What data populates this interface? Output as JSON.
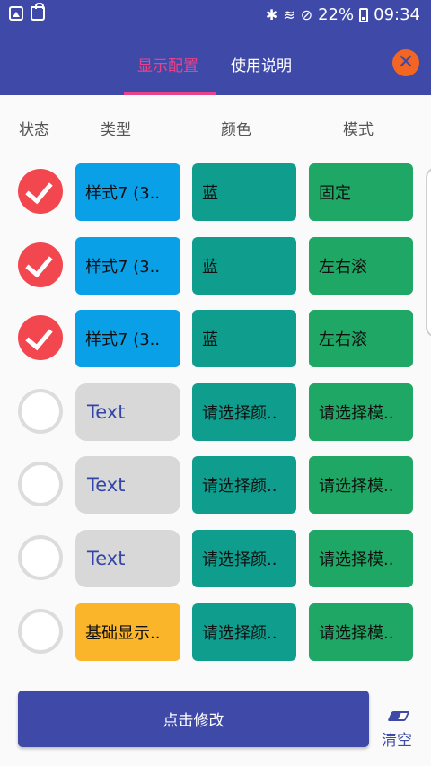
{
  "status_bar": {
    "battery": "22%",
    "time": "09:34",
    "icons": [
      "image-icon",
      "bag-icon",
      "bluetooth-icon",
      "wifi-icon",
      "dnd-icon",
      "battery-icon"
    ]
  },
  "tabs": [
    {
      "label": "显示配置",
      "active": true
    },
    {
      "label": "使用说明",
      "active": false
    }
  ],
  "close_icon": "close-icon",
  "headers": {
    "status": "状态",
    "type": "类型",
    "color": "颜色",
    "mode": "模式"
  },
  "rows": [
    {
      "checked": true,
      "type": "样式7 (3..",
      "color": "蓝",
      "mode": "固定"
    },
    {
      "checked": true,
      "type": "样式7 (3..",
      "color": "蓝",
      "mode": "左右滚"
    },
    {
      "checked": true,
      "type": "样式7 (3..",
      "color": "蓝",
      "mode": "左右滚"
    },
    {
      "checked": false,
      "type": "Text",
      "color": "请选择颜..",
      "mode": "请选择模.."
    },
    {
      "checked": false,
      "type": "Text",
      "color": "请选择颜..",
      "mode": "请选择模.."
    },
    {
      "checked": false,
      "type": "Text",
      "color": "请选择颜..",
      "mode": "请选择模.."
    },
    {
      "checked": false,
      "type": "基础显示..",
      "color": "请选择颜..",
      "mode": "请选择模.."
    }
  ],
  "submit_label": "点击修改",
  "clear_label": "清空",
  "colors": {
    "primary": "#3f4aa8",
    "accent": "#e8438a",
    "check_on": "#f2474f",
    "type_blue": "#0aa0e8",
    "type_yellow": "#fbb52a",
    "color_cell": "#0f9e8e",
    "mode_cell": "#1fa865"
  }
}
